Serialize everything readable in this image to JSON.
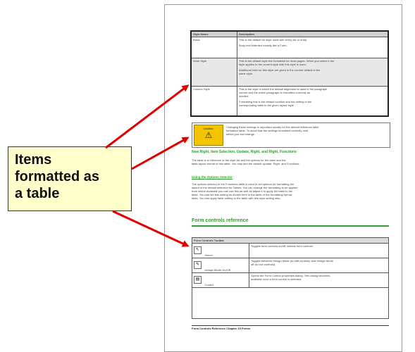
{
  "callout": {
    "lines": [
      "Items",
      "formatted as",
      "a table"
    ]
  },
  "document": {
    "table1": {
      "headers": [
        "Style Name",
        "Description"
      ],
      "rows": [
        {
          "name": "Basic",
          "lines": [
            "This is the default for style used with every list or entry.",
            "Body text indented exactly like a Form."
          ]
        },
        {
          "name": "Wide Style",
          "lines": [
            "This is the default style line formatted for most pages. When you select it the",
            "style applies to the current style with this style is used.",
            "Additional lines for this style are given in the current default in the",
            "same style."
          ]
        },
        {
          "name": "Column Style",
          "lines": [
            "This is the style in which the default alignment is used in the paragraph",
            "current and the entire paragraph is formatted correctly as",
            "needed.",
            "Formatting this is the default location and the setting in the",
            "corresponding table in the given layout style."
          ]
        }
      ]
    },
    "caution": {
      "label": "Caution:",
      "lines": [
        "Changing these settings is important usually for the default reference label",
        "formatted table. To avoid that the settings formatted correctly, add",
        "tables you can change."
      ]
    },
    "heading1": "New Right, Item Selection, Update, Right, and Right, Functions",
    "paragraph1": [
      "The table is a reference of the style list and the options for the table and the",
      "table layout format of this table. You may find the default Update, Right, and Functions."
    ],
    "heading2": "Using the Options Selector",
    "paragraph2": [
      "The options selector in the Functions table is used to set options for formatting the",
      "layout of the default selection for Tables. You can change the formatting to be applied",
      "from where available you can use this as well as adjust it to apply the table to the",
      "table. You can set this setting as shown here in the table of the formatting format",
      "table. You can apply table setting to the table with this style setting also."
    ],
    "heading3": "Form controls reference",
    "table2": {
      "header": "Form Controls Toolbar",
      "rows": [
        {
          "icon": "select-icon",
          "name": "Select",
          "lines": [
            "Toggles form controls on/off; selects form controls."
          ]
        },
        {
          "icon": "design-mode-icon",
          "name": "Design Mode On/Off",
          "lines": [
            "Toggles between Design Mode (to edit controls) and Design Mode",
            "off (to use controls)."
          ]
        },
        {
          "icon": "control-icon",
          "name": "Control",
          "lines": [
            "Opens the Form Control properties dialog. This dialog becomes",
            "available once a form control is selected."
          ]
        }
      ]
    },
    "footer": "Form Controls Reference  Chapter 15 Forms"
  },
  "colors": {
    "callout_bg": "#ffffcc",
    "arrow": "#e00000",
    "heading_green": "#2e9e2e",
    "caution_bg": "#f2c500"
  }
}
